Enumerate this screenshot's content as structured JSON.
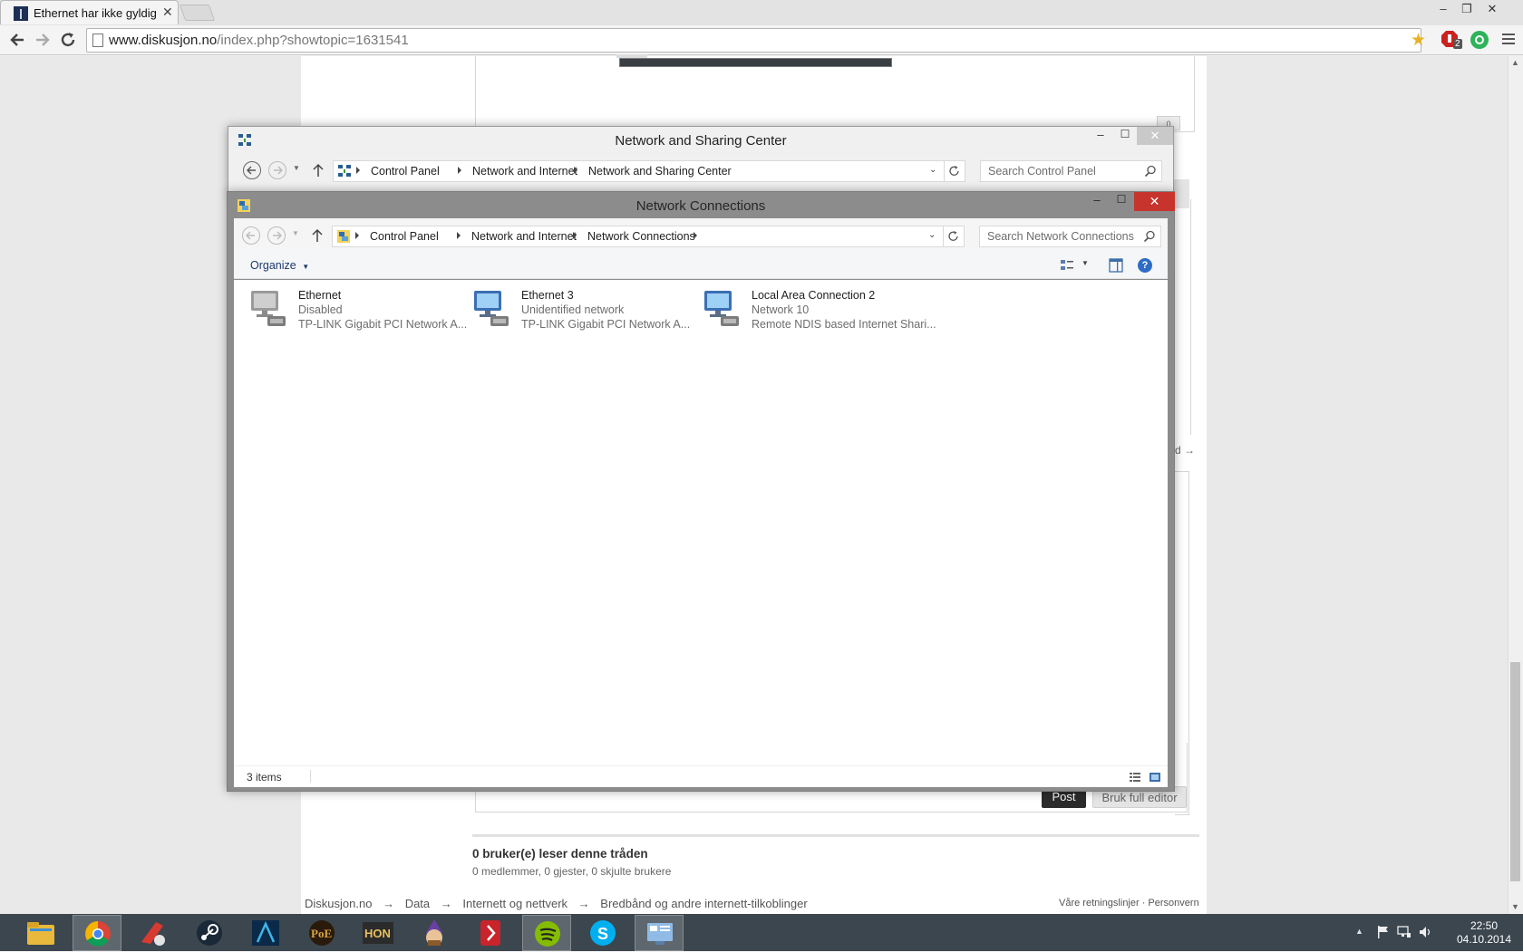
{
  "browser": {
    "tab_title": "Ethernet har ikke gyldig ip",
    "url_host": "www.diskusjon.no",
    "url_path": "/index.php?showtopic=1631541",
    "extension_badge": "2"
  },
  "forum": {
    "partial_link": "d →",
    "post_count_badge": "0",
    "post_button": "Post",
    "full_editor_button": "Bruk full editor",
    "readers_heading": "0 bruker(e) leser denne tråden",
    "readers_detail": "0 medlemmer, 0 gjester, 0 skjulte brukere",
    "breadcrumb": [
      "Diskusjon.no",
      "Data",
      "Internett og nettverk",
      "Bredbånd og andre internett-tilkoblinger"
    ],
    "breadcrumb_sep": "→",
    "footer_links": "Våre retningslinjer · Personvern"
  },
  "nsc_window": {
    "title": "Network and Sharing Center",
    "crumbs": [
      "Control Panel",
      "Network and Internet",
      "Network and Sharing Center"
    ],
    "search_placeholder": "Search Control Panel"
  },
  "nc_window": {
    "title": "Network Connections",
    "crumbs": [
      "Control Panel",
      "Network and Internet",
      "Network Connections"
    ],
    "search_placeholder": "Search Network Connections",
    "organize_label": "Organize",
    "status_items": "3 items",
    "connections": [
      {
        "name": "Ethernet",
        "status": "Disabled",
        "device": "TP-LINK  Gigabit  PCI  Network  A..."
      },
      {
        "name": "Ethernet 3",
        "status": "Unidentified network",
        "device": "TP-LINK  Gigabit  PCI  Network  A..."
      },
      {
        "name": "Local Area Connection 2",
        "status": "Network  10",
        "device": "Remote NDIS based Internet Shari..."
      }
    ]
  },
  "taskbar": {
    "apps": [
      "file-explorer",
      "chrome",
      "ccleaner",
      "steam",
      "league-launcher",
      "path-of-exile",
      "heroes-of-newerth",
      "game-wizard",
      "game-red",
      "spotify",
      "skype",
      "control-panel"
    ],
    "clock_time": "22:50",
    "clock_date": "04.10.2014"
  },
  "colors": {
    "taskbar": "#3b464f",
    "close_red": "#c7342d",
    "win_border_active": "#8c8c8c",
    "link_blue": "#1e3a6e"
  }
}
